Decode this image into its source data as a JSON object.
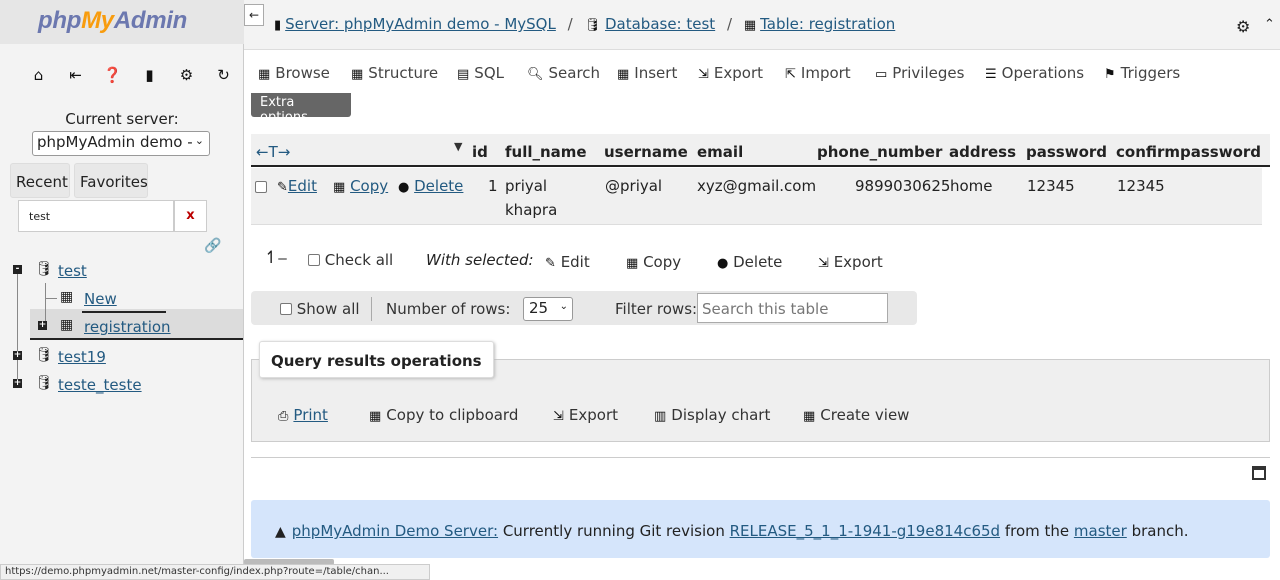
{
  "sidebar": {
    "logo_php": "php",
    "logo_my": "My",
    "logo_admin": "Admin",
    "current_server_label": "Current server:",
    "server_select_value": "phpMyAdmin demo - ",
    "recent_tab": "Recent",
    "favorites_tab": "Favorites",
    "filter_value": "test",
    "filter_clear": "x",
    "tree": {
      "db_test": "test",
      "new": "New",
      "registration": "registration",
      "db_test19": "test19",
      "db_teste_teste": "teste_teste"
    }
  },
  "breadcrumb": {
    "server": "Server: phpMyAdmin demo - MySQL",
    "database": "Database: test",
    "table": "Table: registration"
  },
  "tabs": {
    "browse": "Browse",
    "structure": "Structure",
    "sql": "SQL",
    "search": "Search",
    "insert": "Insert",
    "export": "Export",
    "import": "Import",
    "privileges": "Privileges",
    "operations": "Operations",
    "triggers": "Triggers"
  },
  "extra_options": "Extra options",
  "table": {
    "sort_arrows": "←T→",
    "columns": [
      "id",
      "full_name",
      "username",
      "email",
      "phone_number",
      "address",
      "password",
      "confirmpassword"
    ],
    "row_actions": {
      "edit": "Edit",
      "copy": "Copy",
      "delete": "Delete"
    },
    "row": {
      "id": "1",
      "full_name_1": "priyal",
      "full_name_2": "khapra",
      "username": "@priyal",
      "email": "xyz@gmail.com",
      "phone_number": "9899030625",
      "address": "home",
      "password": "12345",
      "confirmpassword": "12345"
    }
  },
  "with_selected": {
    "check_all": "Check all",
    "label": "With selected:",
    "edit": "Edit",
    "copy": "Copy",
    "delete": "Delete",
    "export": "Export"
  },
  "navbar": {
    "show_all": "Show all",
    "rows_label": "Number of rows:",
    "rows_value": "25",
    "filter_label": "Filter rows:",
    "filter_placeholder": "Search this table"
  },
  "query_ops": {
    "legend": "Query results operations",
    "print": "Print",
    "copy_clipboard": "Copy to clipboard",
    "export": "Export",
    "display_chart": "Display chart",
    "create_view": "Create view"
  },
  "notice": {
    "link1": "phpMyAdmin Demo Server:",
    "text1": " Currently running Git revision ",
    "link2": "RELEASE_5_1_1-1941-g19e814c65d",
    "text2": " from the ",
    "link3": "master",
    "text3": " branch."
  },
  "status_url": "https://demo.phpmyadmin.net/master-config/index.php?route=/table/chan..."
}
